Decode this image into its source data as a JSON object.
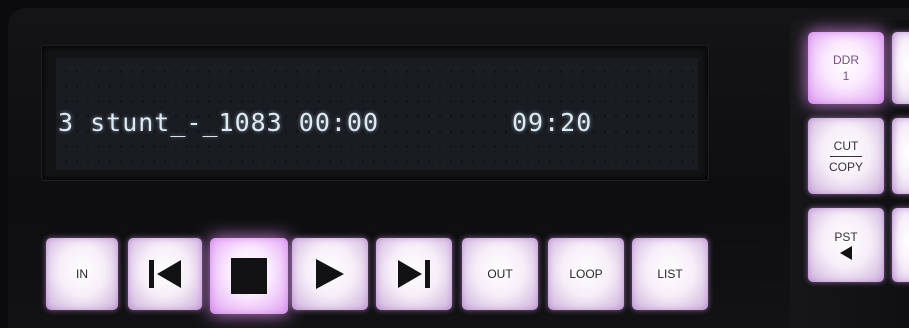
{
  "display": {
    "line_text": "3 stunt_-_1083 00:00",
    "remaining_time": "09:20"
  },
  "transport": {
    "in_label": "IN",
    "out_label": "OUT",
    "loop_label": "LOOP",
    "list_label": "LIST"
  },
  "side_buttons": {
    "ddr_label": "DDR",
    "ddr_number": "1",
    "cut_label": "CUT",
    "copy_label": "COPY",
    "pst_label": "PST"
  },
  "icons": {
    "prev": "skip-previous-icon",
    "stop": "stop-icon",
    "play": "play-icon",
    "next": "skip-next-icon",
    "pst_arrow": "triangle-left-icon"
  },
  "colors": {
    "key_glow": "#e8b8f6",
    "lcd_text": "#dfe9f2",
    "background": "#0b0b0d"
  }
}
